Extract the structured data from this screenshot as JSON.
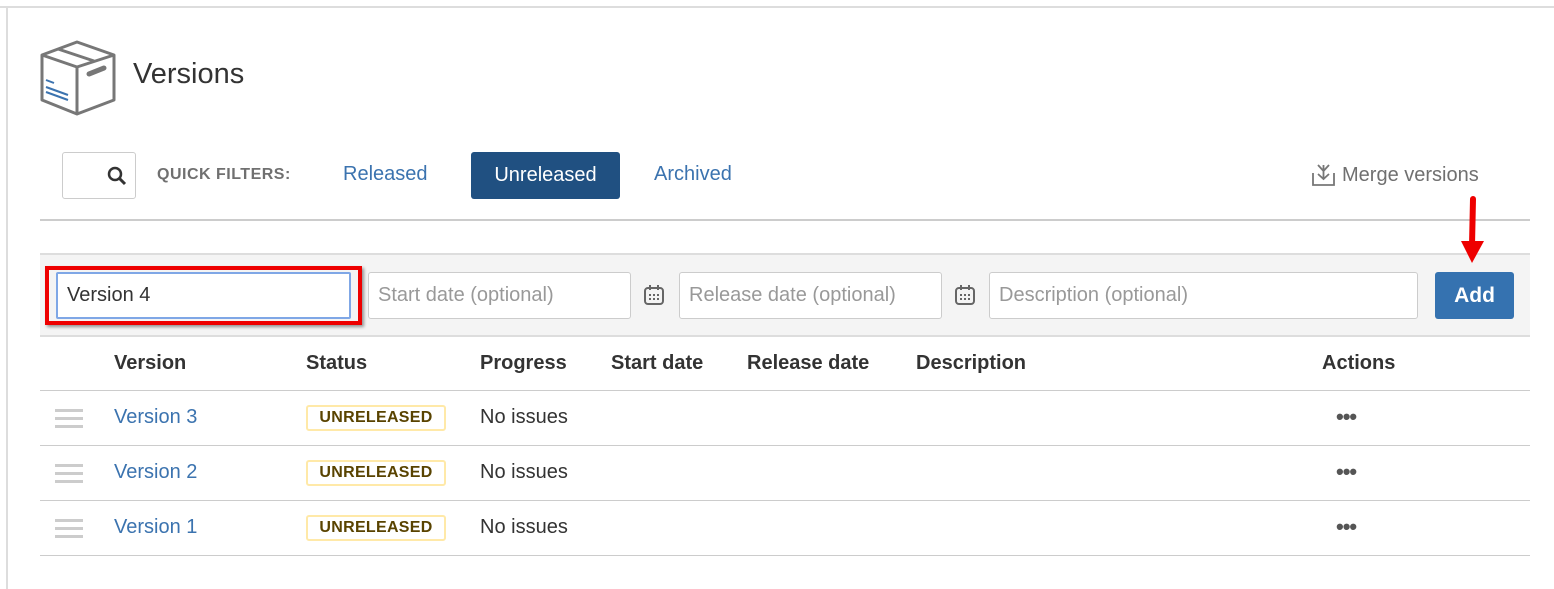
{
  "page": {
    "title": "Versions",
    "icon": "package-box-icon"
  },
  "filters": {
    "label": "QUICK FILTERS:",
    "items": [
      {
        "label": "Released",
        "active": false
      },
      {
        "label": "Unreleased",
        "active": true
      },
      {
        "label": "Archived",
        "active": false
      }
    ],
    "merge_label": "Merge versions",
    "search_value": ""
  },
  "add_form": {
    "name_value": "Version 4",
    "start_placeholder": "Start date (optional)",
    "release_placeholder": "Release date (optional)",
    "description_placeholder": "Description (optional)",
    "add_label": "Add"
  },
  "table": {
    "headers": [
      "Version",
      "Status",
      "Progress",
      "Start date",
      "Release date",
      "Description",
      "Actions"
    ],
    "rows": [
      {
        "version": "Version 3",
        "status": "UNRELEASED",
        "progress": "No issues",
        "start_date": "",
        "release_date": "",
        "description": ""
      },
      {
        "version": "Version 2",
        "status": "UNRELEASED",
        "progress": "No issues",
        "start_date": "",
        "release_date": "",
        "description": ""
      },
      {
        "version": "Version 1",
        "status": "UNRELEASED",
        "progress": "No issues",
        "start_date": "",
        "release_date": "",
        "description": ""
      }
    ]
  },
  "colors": {
    "accent": "#205081",
    "link": "#3b73af",
    "add_button": "#3572b0",
    "highlight": "#ee0000",
    "badge_border": "#ffe9a8",
    "badge_text": "#594300"
  }
}
